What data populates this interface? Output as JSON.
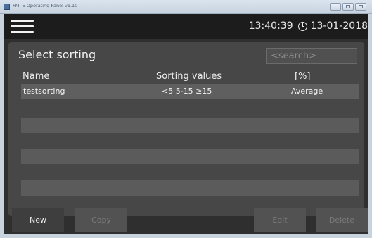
{
  "window": {
    "title": "FMI-5 Operating Panel v1.10"
  },
  "topbar": {
    "time": "13:40:39",
    "date": "13-01-2018"
  },
  "panel": {
    "title": "Select sorting",
    "search_placeholder": "<search>",
    "columns": {
      "name": "Name",
      "values": "Sorting values",
      "percent": "[%]"
    },
    "rows": [
      {
        "name": "testsorting",
        "values": "<5  5-15  ≥15",
        "percent": "Average"
      }
    ]
  },
  "buttons": {
    "new": "New",
    "copy": "Copy",
    "edit": "Edit",
    "delete": "Delete"
  },
  "icons": [
    "app-icon",
    "menu-icon",
    "clock-icon",
    "minimize-icon",
    "maximize-icon",
    "close-icon"
  ],
  "colors": {
    "background": "#2f2f2f",
    "topbar": "#1c1c1c",
    "panel": "#474747",
    "row": "#5b5b5b"
  }
}
